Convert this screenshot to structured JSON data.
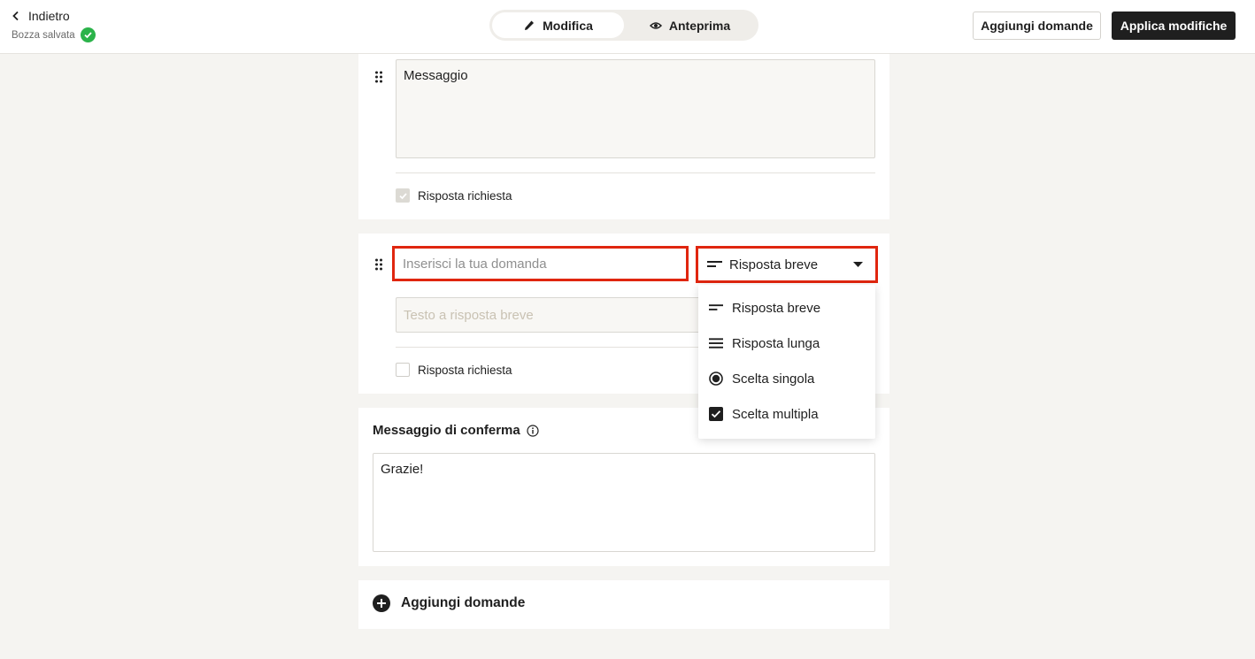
{
  "header": {
    "back_label": "Indietro",
    "saved_label": "Bozza salvata",
    "toggle": {
      "edit_label": "Modifica",
      "preview_label": "Anteprima",
      "active": "edit"
    },
    "add_questions_label": "Aggiungi domande",
    "apply_label": "Applica modifiche"
  },
  "message_question": {
    "value": "Messaggio",
    "required_label": "Risposta richiesta",
    "required_checked": true
  },
  "new_question": {
    "placeholder": "Inserisci la tua domanda",
    "type_selected": "Risposta breve",
    "answer_placeholder": "Testo a risposta breve",
    "required_label": "Risposta richiesta",
    "required_checked": false
  },
  "type_menu": {
    "items": [
      {
        "label": "Risposta breve",
        "icon": "short-lines-icon"
      },
      {
        "label": "Risposta lunga",
        "icon": "long-lines-icon"
      },
      {
        "label": "Scelta singola",
        "icon": "radio-icon"
      },
      {
        "label": "Scelta multipla",
        "icon": "checkbox-icon"
      }
    ]
  },
  "confirmation": {
    "title": "Messaggio di conferma",
    "value": "Grazie!"
  },
  "footer": {
    "add_questions_label": "Aggiungi domande"
  },
  "colors": {
    "highlight": "#e0260f",
    "saved_check": "#2bb34a",
    "primary_dark": "#1f1f1f"
  }
}
